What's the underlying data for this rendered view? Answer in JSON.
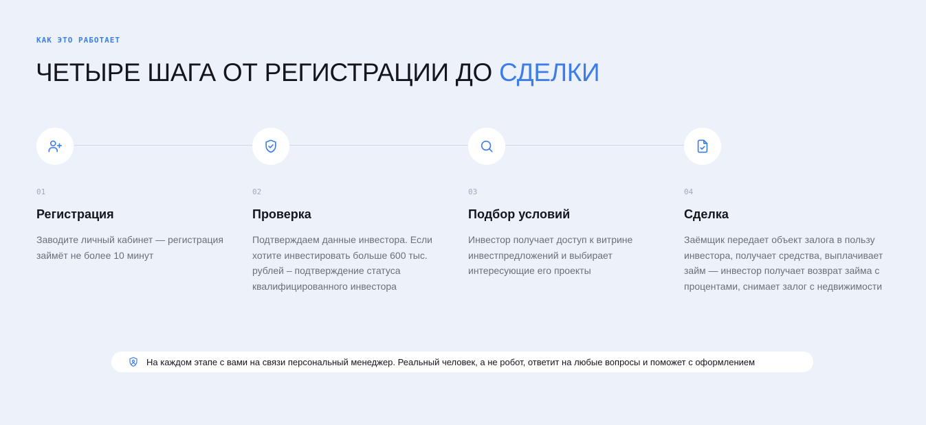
{
  "section": {
    "eyebrow": "КАК ЭТО РАБОТАЕТ",
    "title_main": "ЧЕТЫРЕ ШАГА ОТ РЕГИСТРАЦИИ ДО ",
    "title_accent": "СДЕЛКИ"
  },
  "steps": [
    {
      "number": "01",
      "icon": "user-plus-icon",
      "title": "Регистрация",
      "text": "Заводите личный кабинет — регистрация займёт не более 10 минут"
    },
    {
      "number": "02",
      "icon": "shield-check-icon",
      "title": "Проверка",
      "text": "Подтверждаем данные инвестора. Если хотите инвестировать больше 600 тыс. рублей – подтверждение статуса квалифицированного инвестора"
    },
    {
      "number": "03",
      "icon": "search-icon",
      "title": "Подбор условий",
      "text": "Инвестор получает доступ к витрине инвестпредложений и выбирает интересующие его проекты"
    },
    {
      "number": "04",
      "icon": "file-check-icon",
      "title": "Сделка",
      "text": "Заёмщик передает объект залога в пользу инвестора, получает средства, выплачивает займ — инвестор получает возврат займа с процентами, снимает залог с недвижимости"
    }
  ],
  "note": {
    "icon": "shield-user-icon",
    "text": "На каждом этапе с вами на связи персональный менеджер. Реальный человек, а не робот, ответит на любые вопросы и поможет с оформлением"
  },
  "colors": {
    "background": "#edf1f9",
    "accent": "#3d7ee6",
    "text": "#14161b",
    "muted": "#6b6f78"
  }
}
